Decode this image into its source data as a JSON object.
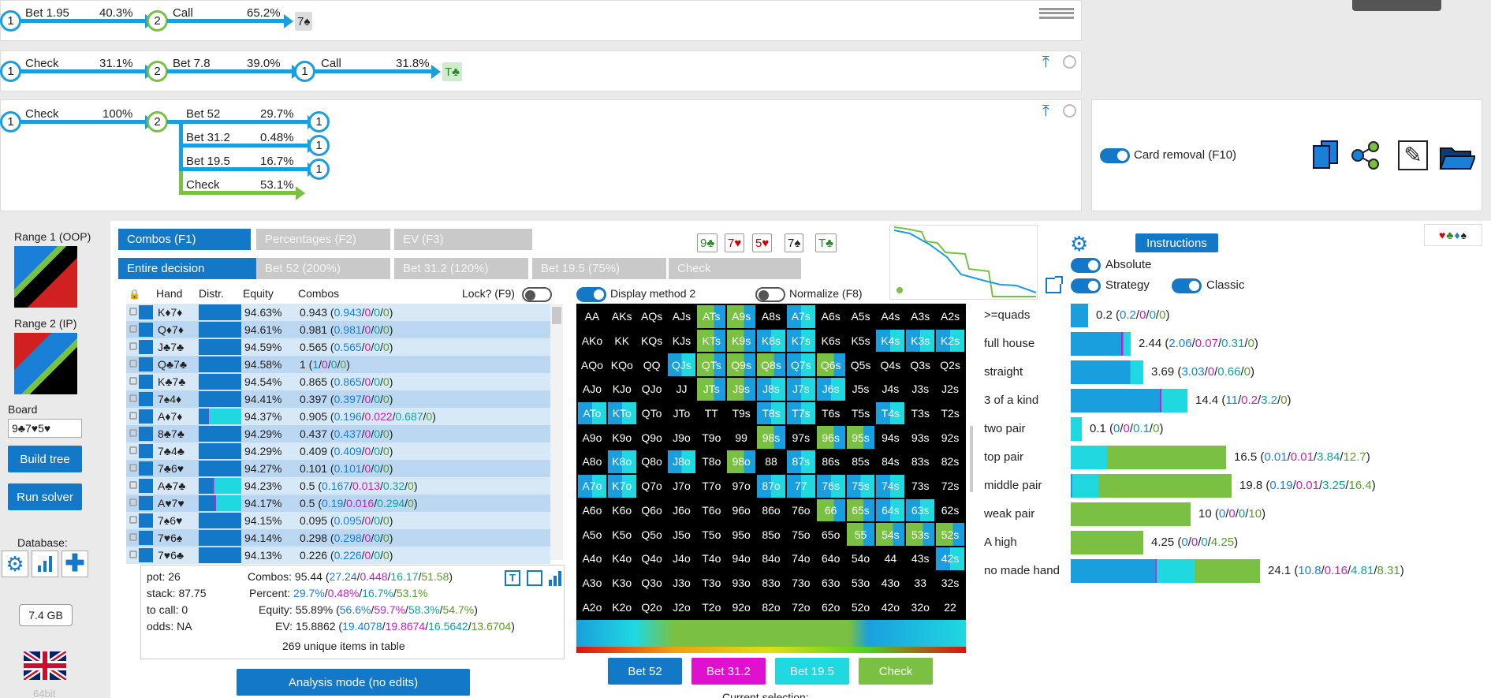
{
  "tree": {
    "line1": {
      "n1": "1",
      "a1": "Bet 1.95",
      "p1": "40.3%",
      "n2": "2",
      "a2": "Call",
      "p2": "65.2%",
      "card": "7♠"
    },
    "line2": {
      "n1": "1",
      "a1": "Check",
      "p1": "31.1%",
      "n2": "2",
      "a2": "Bet 7.8",
      "p2": "39.0%",
      "n3": "1",
      "a3": "Call",
      "p3": "31.8%",
      "card": "T♣"
    },
    "line3": {
      "n1": "1",
      "a1": "Check",
      "p1": "100%",
      "n2": "2",
      "branches": [
        {
          "label": "Bet 52",
          "pct": "29.7%",
          "node": "1"
        },
        {
          "label": "Bet 31.2",
          "pct": "0.48%",
          "node": "1"
        },
        {
          "label": "Bet 19.5",
          "pct": "16.7%",
          "node": "1"
        },
        {
          "label": "Check",
          "pct": "53.1%"
        }
      ]
    }
  },
  "card_removal": "Card removal (F10)",
  "left": {
    "range1": "Range 1 (OOP)",
    "range2": "Range 2 (IP)",
    "board_label": "Board",
    "board_value": "9♣7♥5♥",
    "build": "Build tree",
    "run": "Run solver",
    "database": "Database:",
    "memory": "7.4 GB",
    "bits": "64bit"
  },
  "tabs": {
    "t1": "Combos (F1)",
    "t2": "Percentages (F2)",
    "t3": "EV (F3)",
    "d1": "Entire decision",
    "d2": "Bet 52 (200%)",
    "d3": "Bet 31.2 (120%)",
    "d4": "Bet 19.5 (75%)",
    "d5": "Check"
  },
  "board_cards": [
    "9♣",
    "7♥",
    "5♥",
    "7♠",
    "T♣"
  ],
  "table": {
    "h_hand": "Hand",
    "h_distr": "Distr.",
    "h_eq": "Equity",
    "h_combos": "Combos",
    "lock": "Lock? (F9)",
    "rows": [
      {
        "hand": "K♦7♦",
        "eq": "94.63%",
        "c": "0.943",
        "a": "0.943",
        "b": "0",
        "d": "0",
        "e": "0"
      },
      {
        "hand": "Q♦7♦",
        "eq": "94.61%",
        "c": "0.981",
        "a": "0.981",
        "b": "0",
        "d": "0",
        "e": "0"
      },
      {
        "hand": "J♣7♣",
        "eq": "94.59%",
        "c": "0.565",
        "a": "0.565",
        "b": "0",
        "d": "0",
        "e": "0"
      },
      {
        "hand": "Q♣7♣",
        "eq": "94.58%",
        "c": "1",
        "a": "1",
        "b": "0",
        "d": "0",
        "e": "0"
      },
      {
        "hand": "K♣7♣",
        "eq": "94.54%",
        "c": "0.865",
        "a": "0.865",
        "b": "0",
        "d": "0",
        "e": "0"
      },
      {
        "hand": "7♠4♦",
        "eq": "94.41%",
        "c": "0.397",
        "a": "0.397",
        "b": "0",
        "d": "0",
        "e": "0"
      },
      {
        "hand": "A♦7♦",
        "eq": "94.37%",
        "c": "0.905",
        "a": "0.196",
        "b": "0.022",
        "d": "0.687",
        "e": "0"
      },
      {
        "hand": "8♣7♣",
        "eq": "94.29%",
        "c": "0.437",
        "a": "0.437",
        "b": "0",
        "d": "0",
        "e": "0"
      },
      {
        "hand": "7♣4♣",
        "eq": "94.29%",
        "c": "0.409",
        "a": "0.409",
        "b": "0",
        "d": "0",
        "e": "0"
      },
      {
        "hand": "7♣6♥",
        "eq": "94.27%",
        "c": "0.101",
        "a": "0.101",
        "b": "0",
        "d": "0",
        "e": "0"
      },
      {
        "hand": "A♣7♣",
        "eq": "94.23%",
        "c": "0.5",
        "a": "0.167",
        "b": "0.013",
        "d": "0.32",
        "e": "0"
      },
      {
        "hand": "A♥7♥",
        "eq": "94.17%",
        "c": "0.5",
        "a": "0.19",
        "b": "0.016",
        "d": "0.294",
        "e": "0"
      },
      {
        "hand": "7♠6♥",
        "eq": "94.15%",
        "c": "0.095",
        "a": "0.095",
        "b": "0",
        "d": "0",
        "e": "0"
      },
      {
        "hand": "7♥6♠",
        "eq": "94.14%",
        "c": "0.298",
        "a": "0.298",
        "b": "0",
        "d": "0",
        "e": "0"
      },
      {
        "hand": "7♥6♣",
        "eq": "94.13%",
        "c": "0.226",
        "a": "0.226",
        "b": "0",
        "d": "0",
        "e": "0"
      }
    ]
  },
  "stats": {
    "pot": "pot: 26",
    "stack": "stack: 87.75",
    "tocall": "to call: 0",
    "odds": "odds: NA",
    "combos_l": "Combos:",
    "combos_v": "95.44",
    "combos_a": "27.24",
    "combos_b": "0.448",
    "combos_c": "16.17",
    "combos_d": "51.58",
    "pct_l": "Percent:",
    "pct_v": "29.7%",
    "pct_b": "0.48%",
    "pct_c": "16.7%",
    "pct_d": "53.1%",
    "eq_l": "Equity:",
    "eq_v": "55.89%",
    "eq_a": "56.6%",
    "eq_b": "59.7%",
    "eq_c": "58.3%",
    "eq_d": "54.7%",
    "ev_l": "EV:",
    "ev_v": "15.8862",
    "ev_a": "19.4078",
    "ev_b": "19.8674",
    "ev_c": "16.5642",
    "ev_d": "13.6704",
    "unique": "269 unique items in table",
    "analysis": "Analysis mode (no edits)"
  },
  "matrix": {
    "display": "Display method 2",
    "normalize": "Normalize (F8)",
    "cells": [
      "AA",
      "AKs",
      "AQs",
      "AJs",
      "ATs",
      "A9s",
      "A8s",
      "A7s",
      "A6s",
      "A5s",
      "A4s",
      "A3s",
      "A2s",
      "AKo",
      "KK",
      "KQs",
      "KJs",
      "KTs",
      "K9s",
      "K8s",
      "K7s",
      "K6s",
      "K5s",
      "K4s",
      "K3s",
      "K2s",
      "AQo",
      "KQo",
      "QQ",
      "QJs",
      "QTs",
      "Q9s",
      "Q8s",
      "Q7s",
      "Q6s",
      "Q5s",
      "Q4s",
      "Q3s",
      "Q2s",
      "AJo",
      "KJo",
      "QJo",
      "JJ",
      "JTs",
      "J9s",
      "J8s",
      "J7s",
      "J6s",
      "J5s",
      "J4s",
      "J3s",
      "J2s",
      "ATo",
      "KTo",
      "QTo",
      "JTo",
      "TT",
      "T9s",
      "T8s",
      "T7s",
      "T6s",
      "T5s",
      "T4s",
      "T3s",
      "T2s",
      "A9o",
      "K9o",
      "Q9o",
      "J9o",
      "T9o",
      "99",
      "98s",
      "97s",
      "96s",
      "95s",
      "94s",
      "93s",
      "92s",
      "A8o",
      "K8o",
      "Q8o",
      "J8o",
      "T8o",
      "98o",
      "88",
      "87s",
      "86s",
      "85s",
      "84s",
      "83s",
      "82s",
      "A7o",
      "K7o",
      "Q7o",
      "J7o",
      "T7o",
      "97o",
      "87o",
      "77",
      "76s",
      "75s",
      "74s",
      "73s",
      "72s",
      "A6o",
      "K6o",
      "Q6o",
      "J6o",
      "T6o",
      "96o",
      "86o",
      "76o",
      "66",
      "65s",
      "64s",
      "63s",
      "62s",
      "A5o",
      "K5o",
      "Q5o",
      "J5o",
      "T5o",
      "95o",
      "85o",
      "75o",
      "65o",
      "55",
      "54s",
      "53s",
      "52s",
      "A4o",
      "K4o",
      "Q4o",
      "J4o",
      "T4o",
      "94o",
      "84o",
      "74o",
      "64o",
      "54o",
      "44",
      "43s",
      "42s",
      "A3o",
      "K3o",
      "Q3o",
      "J3o",
      "T3o",
      "93o",
      "83o",
      "73o",
      "63o",
      "53o",
      "43o",
      "33",
      "32s",
      "A2o",
      "K2o",
      "Q2o",
      "J2o",
      "T2o",
      "92o",
      "82o",
      "72o",
      "62o",
      "52o",
      "42o",
      "32o",
      "22"
    ],
    "actions": [
      "Bet 52",
      "Bet 31.2",
      "Bet 19.5",
      "Check"
    ],
    "current": "Current selection:"
  },
  "colors": {
    "bet52": "#1478c8",
    "bet31": "#e010d0",
    "bet19": "#20d8e0",
    "check": "#7ac143"
  },
  "right": {
    "instructions": "Instructions",
    "absolute": "Absolute",
    "strategy": "Strategy",
    "classic": "Classic",
    "suits": "♥♣♦♠",
    "cats": [
      {
        "name": ">=quads",
        "v": "0.2",
        "a": "0.2",
        "b": "0",
        "c": "0",
        "d": "0"
      },
      {
        "name": "full house",
        "v": "2.44",
        "a": "2.06",
        "b": "0.07",
        "c": "0.31",
        "d": "0"
      },
      {
        "name": "straight",
        "v": "3.69",
        "a": "3.03",
        "b": "0",
        "c": "0.66",
        "d": "0"
      },
      {
        "name": "3 of a kind",
        "v": "14.4",
        "a": "11",
        "b": "0.2",
        "c": "3.2",
        "d": "0"
      },
      {
        "name": "two pair",
        "v": "0.1",
        "a": "0",
        "b": "0",
        "c": "0.1",
        "d": "0"
      },
      {
        "name": "top pair",
        "v": "16.5",
        "a": "0.01",
        "b": "0.01",
        "c": "3.84",
        "d": "12.7"
      },
      {
        "name": "middle pair",
        "v": "19.8",
        "a": "0.19",
        "b": "0.01",
        "c": "3.25",
        "d": "16.4"
      },
      {
        "name": "weak pair",
        "v": "10",
        "a": "0",
        "b": "0",
        "c": "0",
        "d": "10"
      },
      {
        "name": "A high",
        "v": "4.25",
        "a": "0",
        "b": "0",
        "c": "0",
        "d": "4.25"
      },
      {
        "name": "no made hand",
        "v": "24.1",
        "a": "10.8",
        "b": "0.16",
        "c": "4.81",
        "d": "8.31"
      }
    ]
  }
}
